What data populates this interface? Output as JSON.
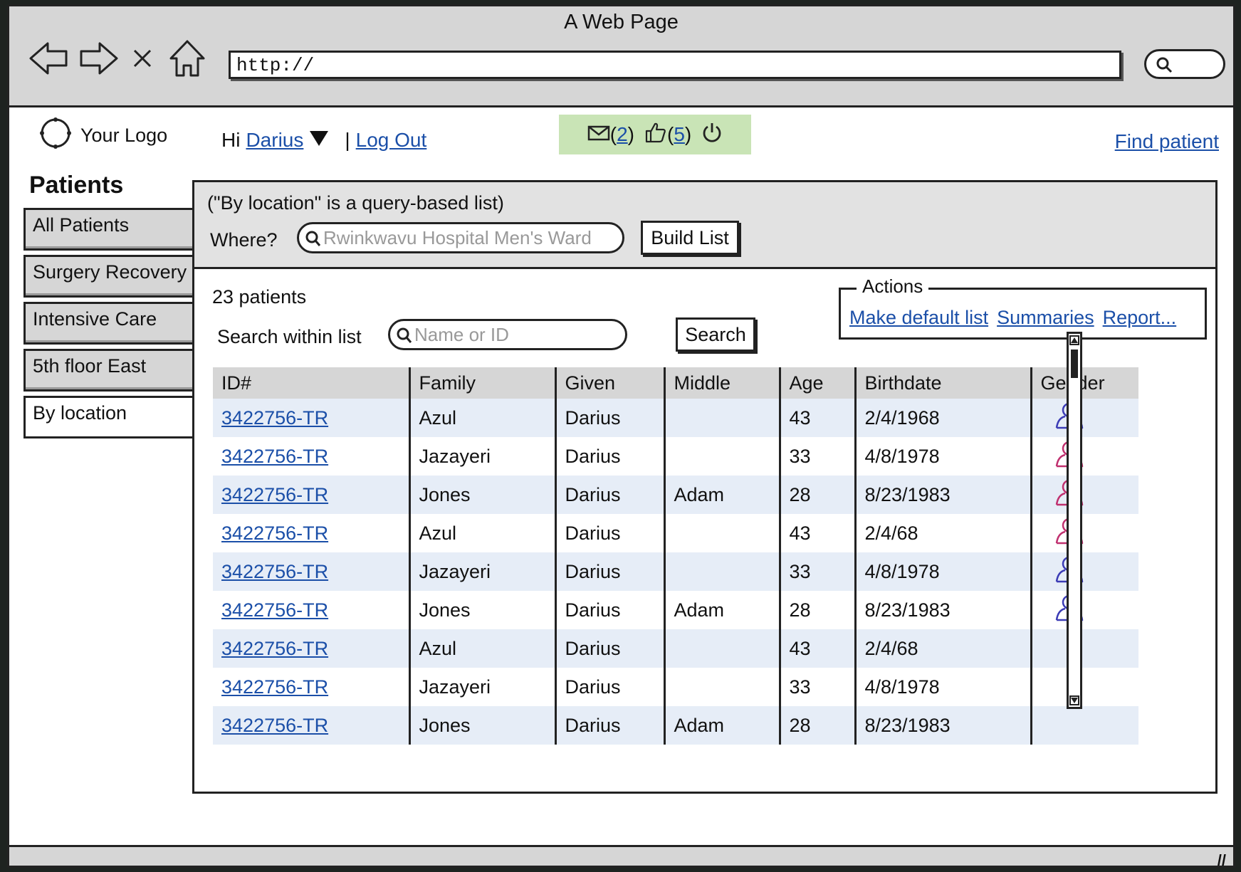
{
  "window": {
    "title": "A Web Page"
  },
  "browser": {
    "url": "http://"
  },
  "header": {
    "logo_text": "Your Logo",
    "greeting": "Hi",
    "user_name": "Darius",
    "separator": "|",
    "logout": "Log Out",
    "messages_count": "2",
    "likes_count": "5",
    "find_patient": "Find patient"
  },
  "sidebar": {
    "title": "Patients",
    "tabs": [
      {
        "label": "All Patients"
      },
      {
        "label": "Surgery Recovery"
      },
      {
        "label": "Intensive Care"
      },
      {
        "label": "5th floor East"
      },
      {
        "label": "By location"
      }
    ],
    "active_tab": "By location"
  },
  "query": {
    "note": "(\"By location\" is a query-based list)",
    "where_label": "Where?",
    "where_placeholder": "Rwinkwavu Hospital Men's Ward",
    "build_button": "Build List"
  },
  "list": {
    "count": "23 patients",
    "search_label": "Search within list",
    "search_placeholder": "Name or ID",
    "search_button": "Search"
  },
  "actions": {
    "title": "Actions",
    "links": [
      "Make default list",
      "Summaries",
      "Report..."
    ]
  },
  "table": {
    "columns": [
      "ID#",
      "Family",
      "Given",
      "Middle",
      "Age",
      "Birthdate",
      "Gender"
    ],
    "rows": [
      {
        "id": "3422756-TR",
        "family": "Azul",
        "given": "Darius",
        "middle": "",
        "age": "43",
        "birthdate": "2/4/1968",
        "gender": "male"
      },
      {
        "id": "3422756-TR",
        "family": "Jazayeri",
        "given": "Darius",
        "middle": "",
        "age": "33",
        "birthdate": "4/8/1978",
        "gender": "female"
      },
      {
        "id": "3422756-TR",
        "family": "Jones",
        "given": "Darius",
        "middle": "Adam",
        "age": "28",
        "birthdate": "8/23/1983",
        "gender": "female"
      },
      {
        "id": "3422756-TR",
        "family": "Azul",
        "given": "Darius",
        "middle": "",
        "age": "43",
        "birthdate": "2/4/68",
        "gender": "female"
      },
      {
        "id": "3422756-TR",
        "family": "Jazayeri",
        "given": "Darius",
        "middle": "",
        "age": "33",
        "birthdate": "4/8/1978",
        "gender": "male"
      },
      {
        "id": "3422756-TR",
        "family": "Jones",
        "given": "Darius",
        "middle": "Adam",
        "age": "28",
        "birthdate": "8/23/1983",
        "gender": "male"
      },
      {
        "id": "3422756-TR",
        "family": "Azul",
        "given": "Darius",
        "middle": "",
        "age": "43",
        "birthdate": "2/4/68",
        "gender": ""
      },
      {
        "id": "3422756-TR",
        "family": "Jazayeri",
        "given": "Darius",
        "middle": "",
        "age": "33",
        "birthdate": "4/8/1978",
        "gender": ""
      },
      {
        "id": "3422756-TR",
        "family": "Jones",
        "given": "Darius",
        "middle": "Adam",
        "age": "28",
        "birthdate": "8/23/1983",
        "gender": ""
      }
    ]
  },
  "colors": {
    "male": "#3b3bb5",
    "female": "#c0306f",
    "notif_bg": "#c9e4b6",
    "link": "#1b4fa8"
  }
}
